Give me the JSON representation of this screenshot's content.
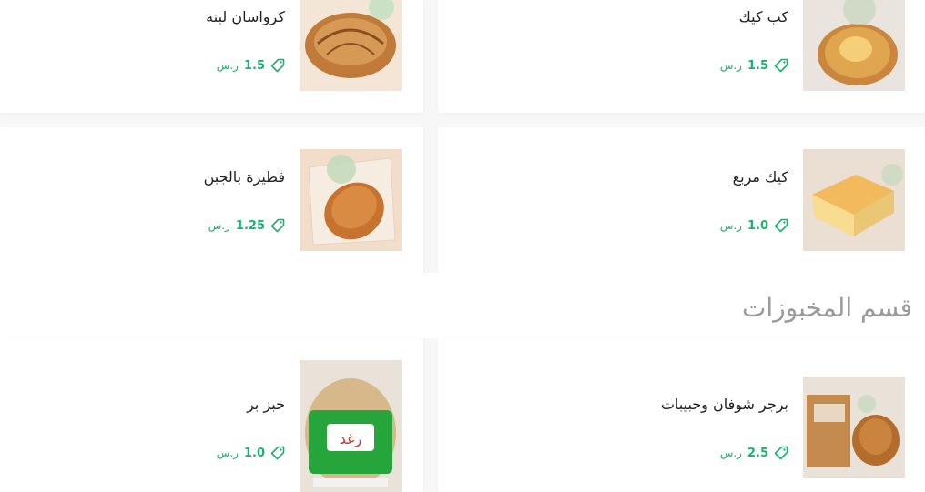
{
  "products": [
    {
      "name": "كرواسان لبنة",
      "price": "1.5",
      "currency": "ر.س"
    },
    {
      "name": "كب كيك",
      "price": "1.5",
      "currency": "ر.س"
    },
    {
      "name": "فطيرة بالجبن",
      "price": "1.25",
      "currency": "ر.س"
    },
    {
      "name": "كيك مربع",
      "price": "1.0",
      "currency": "ر.س"
    },
    {
      "name": "خبز بر",
      "price": "1.0",
      "currency": "ر.س"
    },
    {
      "name": "برجر شوفان وحبيبات",
      "price": "2.5",
      "currency": "ر.س"
    }
  ],
  "section": {
    "title": "قسم المخبوزات"
  },
  "colors": {
    "price": "#19b46a",
    "title": "#9a9a9a",
    "background": "#f7f7f7"
  },
  "icons": {
    "price": "price-tag-icon"
  }
}
